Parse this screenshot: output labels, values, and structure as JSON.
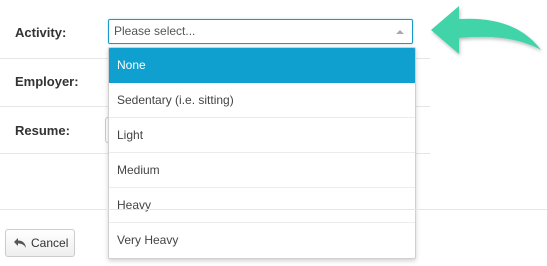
{
  "form": {
    "activity_label": "Activity:",
    "employer_label": "Employer:",
    "resume_label": "Resume:"
  },
  "activity_select": {
    "placeholder": "Please select...",
    "options": [
      "None",
      "Sedentary (i.e. sitting)",
      "Light",
      "Medium",
      "Heavy",
      "Very Heavy"
    ],
    "highlighted_option": "None"
  },
  "footer": {
    "cancel_label": "Cancel"
  },
  "colors": {
    "highlight": "#0fa0d0",
    "arrow": "#3fd4a8"
  },
  "icons": {
    "cancel": "reply-arrow-icon",
    "pointer": "curved-arrow-icon"
  }
}
